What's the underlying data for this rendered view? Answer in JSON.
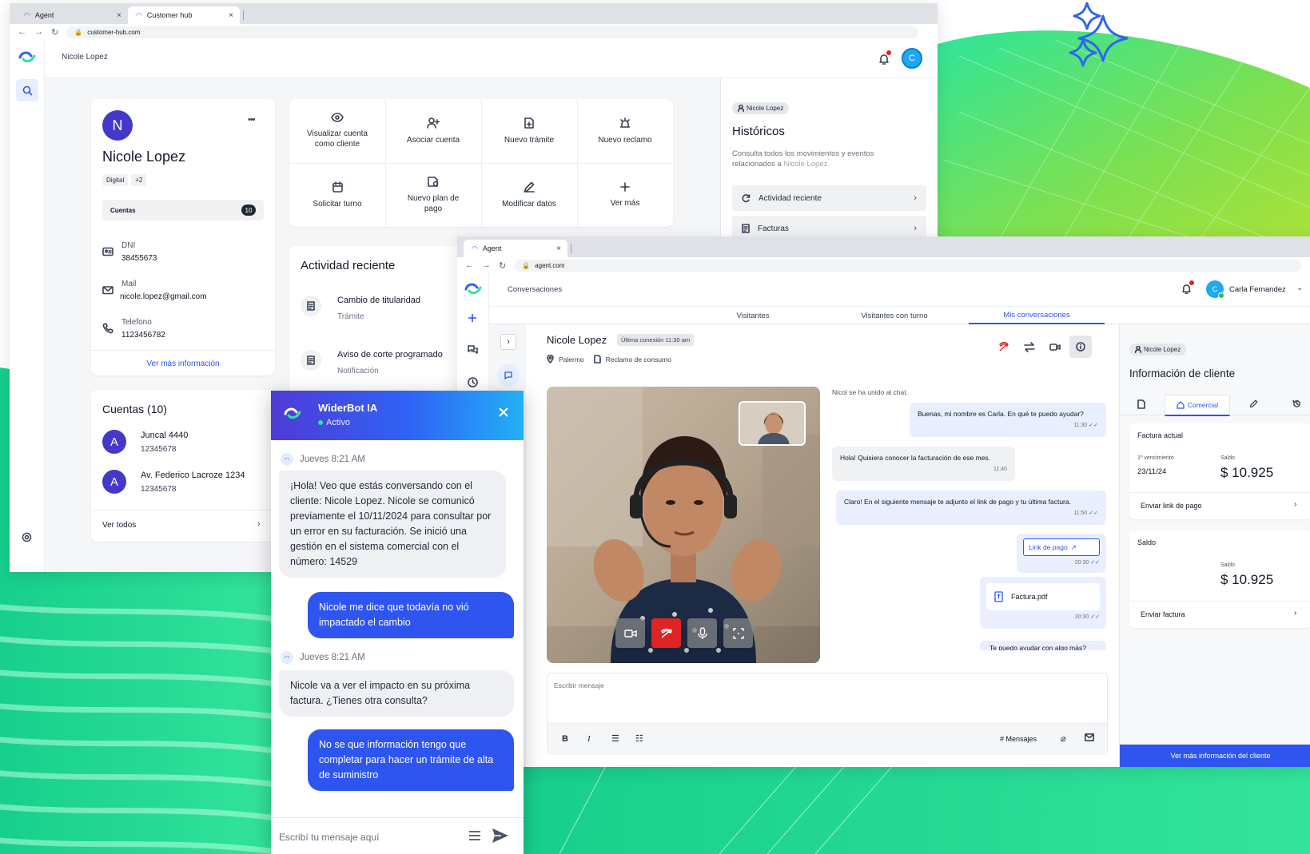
{
  "window1": {
    "tabs": [
      {
        "label": "Agent"
      },
      {
        "label": "Customer hub"
      }
    ],
    "url": "customer-hub.com",
    "header_name": "Nicole Lopez",
    "user_avatar_initial": "C",
    "profile": {
      "initial": "N",
      "name": "Nicole Lopez",
      "menu": "•••",
      "tags": [
        "Digital",
        "+2"
      ],
      "cuentas_label": "Cuentas",
      "cuentas_count": "10",
      "fields": [
        {
          "label": "DNI",
          "value": "38455673",
          "icon": "id-card-icon"
        },
        {
          "label": "Mail",
          "value": "nicole.lopez@gmail.com",
          "icon": "mail-icon"
        },
        {
          "label": "Telefono",
          "value": "1123456782",
          "icon": "phone-icon"
        }
      ],
      "more_info": "Ver más información"
    },
    "actions": [
      {
        "label": "Visualizar cuenta como cliente",
        "icon": "eye-icon"
      },
      {
        "label": "Asociar cuenta",
        "icon": "user-plus-icon"
      },
      {
        "label": "Nuevo trámite",
        "icon": "file-plus-icon"
      },
      {
        "label": "Nuevo reclamo",
        "icon": "alarm-icon"
      },
      {
        "label": "Solicitar turno",
        "icon": "calendar-icon"
      },
      {
        "label": "Nuevo plan de pago",
        "icon": "payment-plan-icon"
      },
      {
        "label": "Modificar datos",
        "icon": "edit-icon"
      },
      {
        "label": "Ver más",
        "icon": "plus-icon"
      }
    ],
    "activity": {
      "title": "Actividad reciente",
      "items": [
        {
          "title": "Cambio de titularidad",
          "sub": "Trámite"
        },
        {
          "title": "Aviso de corte programado",
          "sub": "Notificación"
        }
      ]
    },
    "accounts": {
      "title": "Cuentas (10)",
      "items": [
        {
          "initial": "A",
          "name": "Juncal 4440",
          "num": "12345678"
        },
        {
          "initial": "A",
          "name": "Av. Federico Lacroze 1234",
          "num": "12345678"
        }
      ],
      "see_all": "Ver todos"
    },
    "historicos": {
      "chip": "Nicole Lopez",
      "title": "Históricos",
      "desc_1": "Consulta todos los movimientos y eventos",
      "desc_2": "relacionados a",
      "desc_name": "Nicole Lopez.",
      "buttons": [
        {
          "label": "Actividad reciente"
        },
        {
          "label": "Facturas"
        }
      ]
    }
  },
  "window2": {
    "tabs": [
      {
        "label": "Agent"
      }
    ],
    "url": "agent.com",
    "section": "Conversaciones",
    "agent_initial": "C",
    "agent_name": "Carla Fernandez",
    "conv_tabs": [
      {
        "label": "Visitantes",
        "active": false
      },
      {
        "label": "Visitantes con turno",
        "active": false
      },
      {
        "label": "Mis conversaciones",
        "active": true
      }
    ],
    "chat": {
      "name": "Nicole Lopez",
      "last_seen": "Última conexión 11:30 am",
      "location": "Palermo",
      "topic": "Reclamo de consumo",
      "system": "Nicol se ha unido al chat.",
      "messages": [
        {
          "from": "agent",
          "text": "Buenas, mi nombre es Carla. En qué te puedo ayudar?",
          "time": "11:30"
        },
        {
          "from": "user",
          "text": "Hola! Quisiera conocer la facturación de ese mes.",
          "time": "11:40"
        },
        {
          "from": "agent",
          "text": "Claro! En el siguiente mensaje te adjunto el link de pago y tu última factura.",
          "time": "11:50"
        }
      ],
      "link_label": "Link de pago",
      "link_time": "20:30",
      "file_name": "Factura.pdf",
      "file_time": "20:30",
      "cut_msg": "Te puedo ayudar con algo más?",
      "input_placeholder": "Escribir mensaje",
      "mensajes_label": "# Mensajes"
    },
    "client": {
      "chip": "Nicole Lopez",
      "title": "Información de cliente",
      "active_tab": "Comercial",
      "factura_title": "Factura actual",
      "venc_label": "1º vencimiento",
      "venc_value": "23/11/24",
      "saldo_label": "Saldo",
      "saldo_value": "$ 10.925",
      "send_link": "Enviar link de pago",
      "saldo_title": "Saldo",
      "saldo2_label": "Saldo",
      "saldo2_value": "$ 10.925",
      "send_invoice": "Enviar factura",
      "cta": "Ver más información del cliente"
    }
  },
  "bot": {
    "name": "WiderBot IA",
    "status": "Activo",
    "messages": [
      {
        "type": "time",
        "text": "Jueves 8:21 AM"
      },
      {
        "type": "ai",
        "text": "¡Hola! Veo que estás conversando con el cliente: Nicole Lopez. Nicole se comunicó previamente el 10/11/2024 para consultar por un error en su facturación. Se inició una gestión en el sistema comercial con el número: 14529"
      },
      {
        "type": "me",
        "text": "Nicole me dice que todavía no vió impactado el cambio"
      },
      {
        "type": "time",
        "text": "Jueves 8:21 AM"
      },
      {
        "type": "ai",
        "text": "Nicole va a ver el impacto en su próxima factura. ¿Tienes otra consulta?"
      },
      {
        "type": "me",
        "text": "No se que información tengo que completar para hacer un trámite de alta de suministro"
      }
    ],
    "input_placeholder": "Escribí tu mensaje aquí"
  },
  "colors": {
    "green": "#2ee59a",
    "lime": "#8ee24a",
    "brand_blue": "#2f55f0",
    "avatar_blue": "#1fa8f3",
    "indigo": "#4338ca",
    "danger": "#e02424"
  }
}
